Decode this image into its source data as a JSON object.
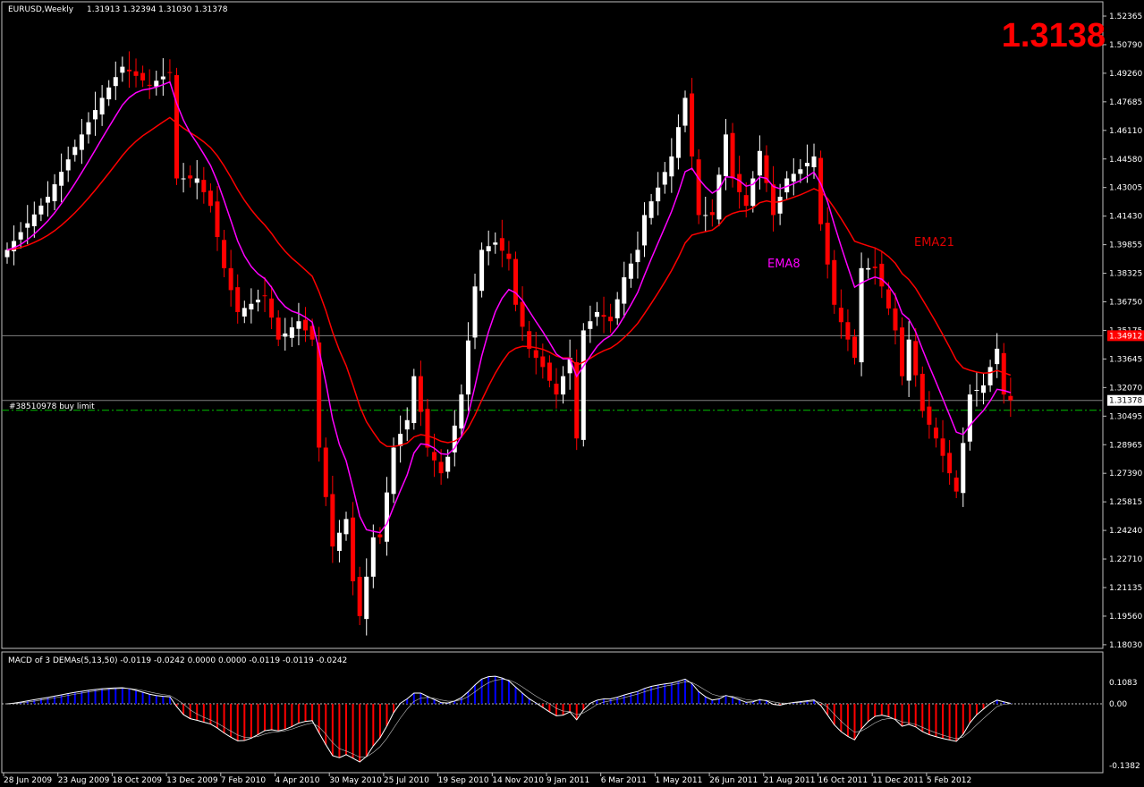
{
  "header": {
    "symbol": "EURUSD,Weekly",
    "ohlc": "1.31913 1.32394 1.31030 1.31378"
  },
  "big_price": "1.3138",
  "colors": {
    "bull": "#ffffff",
    "bear": "#ff0000",
    "ema8": "#ff00ff",
    "ema21": "#ff0000",
    "macd_pos": "#0000ff",
    "macd_neg": "#ff0000",
    "order_line": "#00c000",
    "big_price": "#ff0000"
  },
  "labels": {
    "ema8": "EMA8",
    "ema21": "EMA21",
    "order": "#38510978 buy limit"
  },
  "price_axis": {
    "ticks": [
      "1.52365",
      "1.50790",
      "1.49260",
      "1.47685",
      "1.46110",
      "1.44580",
      "1.43005",
      "1.41430",
      "1.39855",
      "1.38325",
      "1.36750",
      "1.35175",
      "1.33645",
      "1.32070",
      "1.30495",
      "1.28965",
      "1.27390",
      "1.25815",
      "1.24240",
      "1.22710",
      "1.21135",
      "1.19560",
      "1.18030"
    ],
    "marker_red": "1.34912",
    "marker_current": "1.31378"
  },
  "order_price": 1.3084,
  "macd": {
    "title": "MACD of 3 DEMAs(5,13,50) -0.0119 -0.0242 0.0000 0.0000 -0.0119 -0.0119 -0.0242",
    "ticks": [
      "0.1083",
      "0.00",
      "-0.1382"
    ]
  },
  "date_axis": [
    "28 Jun 2009",
    "23 Aug 2009",
    "18 Oct 2009",
    "13 Dec 2009",
    "7 Feb 2010",
    "4 Apr 2010",
    "30 May 2010",
    "25 Jul 2010",
    "19 Sep 2010",
    "14 Nov 2010",
    "9 Jan 2011",
    "6 Mar 2011",
    "1 May 2011",
    "26 Jun 2011",
    "21 Aug 2011",
    "16 Oct 2011",
    "11 Dec 2011",
    "5 Feb 2012"
  ],
  "chart_data": {
    "type": "candlestick",
    "weeks": 149,
    "ylim": [
      1.1803,
      1.52365
    ],
    "close_waypoints": [
      [
        0,
        1.396
      ],
      [
        6,
        1.425
      ],
      [
        11,
        1.459
      ],
      [
        14,
        1.479
      ],
      [
        17,
        1.496
      ],
      [
        21,
        1.486
      ],
      [
        24,
        1.493
      ],
      [
        25,
        1.435
      ],
      [
        28,
        1.435
      ],
      [
        30,
        1.42
      ],
      [
        32,
        1.386
      ],
      [
        34,
        1.362
      ],
      [
        38,
        1.371
      ],
      [
        40,
        1.347
      ],
      [
        43,
        1.357
      ],
      [
        45,
        1.347
      ],
      [
        46,
        1.288
      ],
      [
        48,
        1.234
      ],
      [
        50,
        1.249
      ],
      [
        51,
        1.215
      ],
      [
        52,
        1.196
      ],
      [
        54,
        1.239
      ],
      [
        55,
        1.239
      ],
      [
        57,
        1.288
      ],
      [
        59,
        1.303
      ],
      [
        60,
        1.327
      ],
      [
        62,
        1.288
      ],
      [
        64,
        1.274
      ],
      [
        65,
        1.283
      ],
      [
        67,
        1.317
      ],
      [
        69,
        1.376
      ],
      [
        70,
        1.396
      ],
      [
        72,
        1.4
      ],
      [
        74,
        1.391
      ],
      [
        75,
        1.366
      ],
      [
        77,
        1.342
      ],
      [
        79,
        1.332
      ],
      [
        81,
        1.317
      ],
      [
        83,
        1.337
      ],
      [
        84,
        1.293
      ],
      [
        85,
        1.352
      ],
      [
        87,
        1.362
      ],
      [
        89,
        1.357
      ],
      [
        91,
        1.381
      ],
      [
        93,
        1.396
      ],
      [
        94,
        1.415
      ],
      [
        96,
        1.43
      ],
      [
        98,
        1.447
      ],
      [
        100,
        1.479
      ],
      [
        102,
        1.415
      ],
      [
        104,
        1.415
      ],
      [
        106,
        1.459
      ],
      [
        107,
        1.435
      ],
      [
        109,
        1.42
      ],
      [
        111,
        1.45
      ],
      [
        113,
        1.415
      ],
      [
        115,
        1.435
      ],
      [
        117,
        1.44
      ],
      [
        119,
        1.447
      ],
      [
        120,
        1.41
      ],
      [
        122,
        1.366
      ],
      [
        124,
        1.347
      ],
      [
        125,
        1.337
      ],
      [
        126,
        1.386
      ],
      [
        128,
        1.386
      ],
      [
        129,
        1.376
      ],
      [
        131,
        1.352
      ],
      [
        132,
        1.327
      ],
      [
        133,
        1.347
      ],
      [
        135,
        1.308
      ],
      [
        137,
        1.293
      ],
      [
        139,
        1.274
      ],
      [
        140,
        1.264
      ],
      [
        142,
        1.317
      ],
      [
        144,
        1.322
      ],
      [
        146,
        1.342
      ],
      [
        147,
        1.317
      ],
      [
        148,
        1.3138
      ]
    ]
  }
}
